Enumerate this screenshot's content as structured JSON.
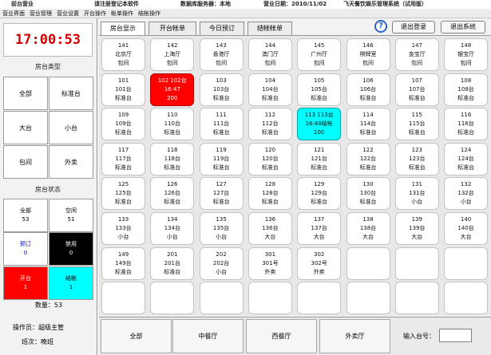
{
  "title_bar": {
    "left": "前台营业",
    "notice": "请注册登记本软件",
    "server": "数据库服务器：本地",
    "date": "营业日期：2010/11/02",
    "app": "飞天餐饮娱乐管理系统（试用版）"
  },
  "menu": [
    "营业界面",
    "营业管理",
    "营业设置",
    "开台操作",
    "帐单操作",
    "结帐操作"
  ],
  "clock": "17:00:53",
  "table_types": {
    "heading": "房台类型",
    "buttons": [
      "全部",
      "标准台",
      "大台",
      "小台",
      "包间",
      "外卖"
    ]
  },
  "table_status": {
    "heading": "房台状态",
    "items": [
      {
        "label": "全部",
        "count": "53",
        "bg": "#ffffff",
        "color": "#000000"
      },
      {
        "label": "空闲",
        "count": "51",
        "bg": "#ffffff",
        "color": "#000000"
      },
      {
        "label": "预订",
        "count": "0",
        "bg": "#ffffff",
        "color": "#0000cc"
      },
      {
        "label": "禁用",
        "count": "0",
        "bg": "#000000",
        "color": "#ffffff"
      },
      {
        "label": "开台",
        "count": "1",
        "bg": "#ff0000",
        "color": "#ffffff"
      },
      {
        "label": "结帐",
        "count": "1",
        "bg": "#00ffff",
        "color": "#000000"
      }
    ]
  },
  "count_line": "数量：53",
  "operator": "操作员：超级主管",
  "shift": "班次：晚班",
  "tabs": [
    "房台显示",
    "开台帐单",
    "今日预订",
    "结帐帐单"
  ],
  "sys_buttons": [
    "退出登录",
    "退出系统"
  ],
  "tables": [
    [
      "141",
      "北京厅",
      "包间"
    ],
    [
      "142",
      "上海厅",
      "包间"
    ],
    [
      "143",
      "香港厅",
      "包间"
    ],
    [
      "144",
      "澳门厅",
      "包间"
    ],
    [
      "145",
      "广州厅",
      "包间"
    ],
    [
      "146",
      "棋牌室",
      "包间"
    ],
    [
      "147",
      "金宝厅",
      "包间"
    ],
    [
      "148",
      "银宝厅",
      "包间"
    ],
    [
      "101",
      "101台",
      "标准台"
    ],
    [
      "102 102台",
      "16:47",
      "200"
    ],
    [
      "103",
      "103台",
      "标准台"
    ],
    [
      "104",
      "104台",
      "标准台"
    ],
    [
      "105",
      "105台",
      "标准台"
    ],
    [
      "106",
      "106台",
      "标准台"
    ],
    [
      "107",
      "107台",
      "标准台"
    ],
    [
      "108",
      "108台",
      "标准台"
    ],
    [
      "109",
      "109台",
      "标准台"
    ],
    [
      "110",
      "110台",
      "标准台"
    ],
    [
      "111",
      "111台",
      "标准台"
    ],
    [
      "112",
      "112台",
      "标准台"
    ],
    [
      "113 113台",
      "16:48结帐",
      "100"
    ],
    [
      "114",
      "114台",
      "标准台"
    ],
    [
      "115",
      "115台",
      "标准台"
    ],
    [
      "116",
      "116台",
      "标准台"
    ],
    [
      "117",
      "117台",
      "标准台"
    ],
    [
      "118",
      "118台",
      "标准台"
    ],
    [
      "119",
      "119台",
      "标准台"
    ],
    [
      "120",
      "120台",
      "标准台"
    ],
    [
      "121",
      "121台",
      "标准台"
    ],
    [
      "122",
      "122台",
      "标准台"
    ],
    [
      "123",
      "123台",
      "标准台"
    ],
    [
      "124",
      "124台",
      "标准台"
    ],
    [
      "125",
      "125台",
      "标准台"
    ],
    [
      "126",
      "126台",
      "标准台"
    ],
    [
      "127",
      "127台",
      "标准台"
    ],
    [
      "128",
      "128台",
      "标准台"
    ],
    [
      "129",
      "129台",
      "标准台"
    ],
    [
      "130",
      "130台",
      "标准台"
    ],
    [
      "131",
      "131台",
      "小台"
    ],
    [
      "132",
      "132台",
      "小台"
    ],
    [
      "133",
      "133台",
      "小台"
    ],
    [
      "134",
      "134台",
      "小台"
    ],
    [
      "135",
      "135台",
      "小台"
    ],
    [
      "136",
      "136台",
      "大台"
    ],
    [
      "137",
      "137台",
      "大台"
    ],
    [
      "138",
      "138台",
      "大台"
    ],
    [
      "139",
      "139台",
      "大台"
    ],
    [
      "140",
      "140台",
      "大台"
    ],
    [
      "149",
      "149台",
      "标准台"
    ],
    [
      "201",
      "201台",
      "标准台"
    ],
    [
      "202",
      "202台",
      "小台"
    ],
    [
      "301",
      "301号",
      "外卖"
    ],
    [
      "302",
      "302号",
      "外卖"
    ]
  ],
  "open_index": 9,
  "checkout_index": 20,
  "total_slots": 64,
  "area_buttons": [
    "全部",
    "中餐厅",
    "西餐厅",
    "外卖厅"
  ],
  "input": {
    "label": "输入台号：",
    "value": ""
  }
}
